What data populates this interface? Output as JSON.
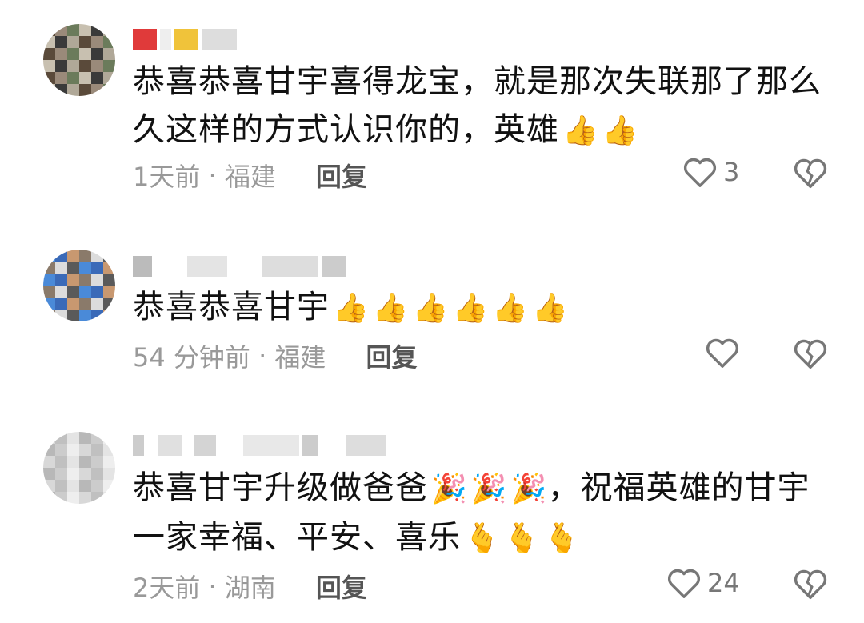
{
  "comments": [
    {
      "text": "恭喜恭喜甘宇喜得龙宝，就是那次失联那了那么久这样的方式认识你的，英雄",
      "emojis": [
        "👍",
        "👍"
      ],
      "time": "1天前",
      "location": "福建",
      "reply_label": "回复",
      "like_count": "3",
      "avatar_colors": [
        "#5a4a3a",
        "#9a8a7a",
        "#6b7b5b",
        "#c8c0b0",
        "#3a3a3a",
        "#b0a898"
      ]
    },
    {
      "text": "恭喜恭喜甘宇",
      "emojis": [
        "👍",
        "👍",
        "👍",
        "👍",
        "👍",
        "👍"
      ],
      "time": "54 分钟前",
      "location": "福建",
      "reply_label": "回复",
      "like_count": "",
      "avatar_colors": [
        "#4a8ad8",
        "#3a6ab8",
        "#c89870",
        "#8a7a6a",
        "#dcdcdc",
        "#5a5a5a"
      ]
    },
    {
      "text": "恭喜甘宇升级做爸爸",
      "emojis": [
        "🎉",
        "🎉",
        "🎉"
      ],
      "text2": "，祝福英雄的甘宇一家幸福、平安、喜乐",
      "emojis2": [
        "🫰",
        "🫰",
        "🫰"
      ],
      "time": "2天前",
      "location": "湖南",
      "reply_label": "回复",
      "like_count": "24",
      "avatar_colors": [
        "#d8d8d8",
        "#c0c0c0",
        "#e4e4e4",
        "#b8b8b8",
        "#cccccc",
        "#eeeeee"
      ]
    }
  ],
  "icons": {
    "like": "heart-outline-icon",
    "dislike": "broken-heart-icon"
  }
}
